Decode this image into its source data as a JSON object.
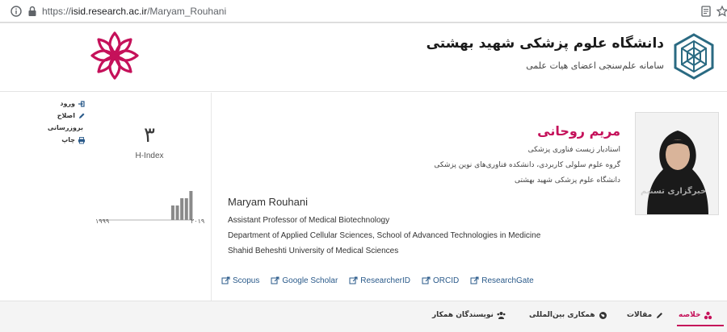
{
  "browser": {
    "url_prefix": "https://",
    "url_host": "isid.research.ac.ir",
    "url_path": "/Maryam_Rouhani"
  },
  "header": {
    "university_name": "دانشگاه علوم پزشکی شهید بهشتی",
    "system_name": "سامانه علم‌سنجی اعضای هیات علمی"
  },
  "actions": [
    {
      "label": "ورود",
      "icon": "sign-in-icon"
    },
    {
      "label": "اصلاح",
      "icon": "pencil-icon"
    },
    {
      "label": "بروزرسانی",
      "icon": "refresh-icon"
    },
    {
      "label": "چاپ",
      "icon": "print-icon"
    }
  ],
  "metrics": {
    "h_index_value": "۳",
    "h_index_label": "H-Index",
    "year_start": "۱۹۹۹",
    "year_end": "۲۰۱۹"
  },
  "chart_data": {
    "type": "bar",
    "title": "",
    "x_range_label": [
      "۱۹۹۹",
      "۲۰۱۹"
    ],
    "values": [
      0,
      0,
      0,
      0,
      0,
      0,
      0,
      0,
      0,
      0,
      0,
      0,
      0,
      0,
      0,
      0,
      2,
      2,
      3,
      3,
      4
    ]
  },
  "person": {
    "name_fa": "مریم روحانی",
    "title_fa": "استادیار زیست فناوری پزشکی",
    "department_fa": "گروه علوم سلولی کاربردی، دانشکده فناوری‌های نوین پزشکی",
    "university_fa": "دانشگاه علوم پزشکی شهید بهشتی",
    "name_en": "Maryam Rouhani",
    "title_en": "Assistant Professor of Medical Biotechnology",
    "department_en": "Department of Applied Cellular Sciences, School of Advanced Technologies in Medicine",
    "university_en": "Shahid Beheshti University of Medical Sciences"
  },
  "links": [
    {
      "label": "Scopus"
    },
    {
      "label": "Google Scholar"
    },
    {
      "label": "ResearcherID"
    },
    {
      "label": "ORCID"
    },
    {
      "label": "ResearchGate"
    }
  ],
  "tabs": [
    {
      "label": "خلاصه",
      "icon": "summary-icon",
      "active": true
    },
    {
      "label": "مقالات",
      "icon": "pencil-icon",
      "active": false
    },
    {
      "label": "همکاری بین‌المللی",
      "icon": "globe-icon",
      "active": false
    },
    {
      "label": "نویسندگان همکار",
      "icon": "users-icon",
      "active": false
    }
  ],
  "watermark": "خبرگزاری تسنیم",
  "colors": {
    "accent": "#c5115a",
    "link": "#2a5a8a",
    "logo": "#2a6a82"
  }
}
